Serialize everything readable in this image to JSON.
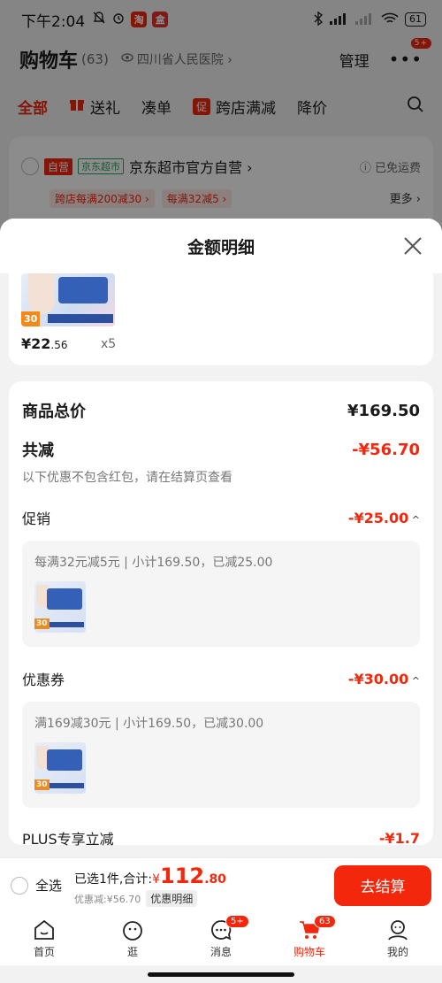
{
  "statusbar": {
    "time": "下午2:04",
    "app1": "淘",
    "app2": "盒",
    "battery": "61"
  },
  "header": {
    "title": "购物车",
    "count": "(63)",
    "location": "四川省人民医院 ›",
    "manage": "管理",
    "more_badge": "5+"
  },
  "tabs": [
    "全部",
    "送礼",
    "凑单",
    "跨店满减",
    "降价"
  ],
  "tabs_promo_icon": "促",
  "shop": {
    "self_tag": "自营",
    "market_tag": "京东超市",
    "name": "京东超市官方自营 ›",
    "ship": "ⓘ 已免运费",
    "promo1": "跨店每满200减30 ›",
    "promo2": "每满32减5 ›",
    "more": "更多 ›"
  },
  "sheet": {
    "title": "金额明细"
  },
  "product": {
    "price_int": "¥22",
    "price_dec": ".56",
    "qty": "x5",
    "badge": "30"
  },
  "summary": {
    "total_label": "商品总价",
    "total_value": "¥169.50",
    "reduce_label": "共减",
    "reduce_value": "-¥56.70",
    "note": "以下优惠不包含红包，请在结算页查看",
    "promo_label": "促销",
    "promo_value": "-¥25.00",
    "promo_desc": "每满32元减5元 | 小计169.50，已减25.00",
    "coupon_label": "优惠券",
    "coupon_value": "-¥30.00",
    "coupon_desc": "满169减30元 | 小计169.50，已减30.00",
    "plus_label": "PLUS专享立减",
    "plus_value": "-¥1.7",
    "thumb_badge": "30"
  },
  "checkout": {
    "select_all": "全选",
    "selected": "已选1件,合计:",
    "currency": "¥",
    "total_int": "112",
    "total_dec": ".80",
    "discount": "优惠减:¥56.70",
    "detail_btn": "优惠明细",
    "go_btn": "去结算"
  },
  "bottomnav": {
    "items": [
      {
        "label": "首页",
        "icon": "home-icon"
      },
      {
        "label": "逛",
        "icon": "browse-icon"
      },
      {
        "label": "消息",
        "icon": "message-icon",
        "badge": "5+"
      },
      {
        "label": "购物车",
        "icon": "cart-icon",
        "badge": "63"
      },
      {
        "label": "我的",
        "icon": "profile-icon"
      }
    ]
  },
  "colors": {
    "accent": "#f2270c",
    "green": "#2aa55a"
  }
}
